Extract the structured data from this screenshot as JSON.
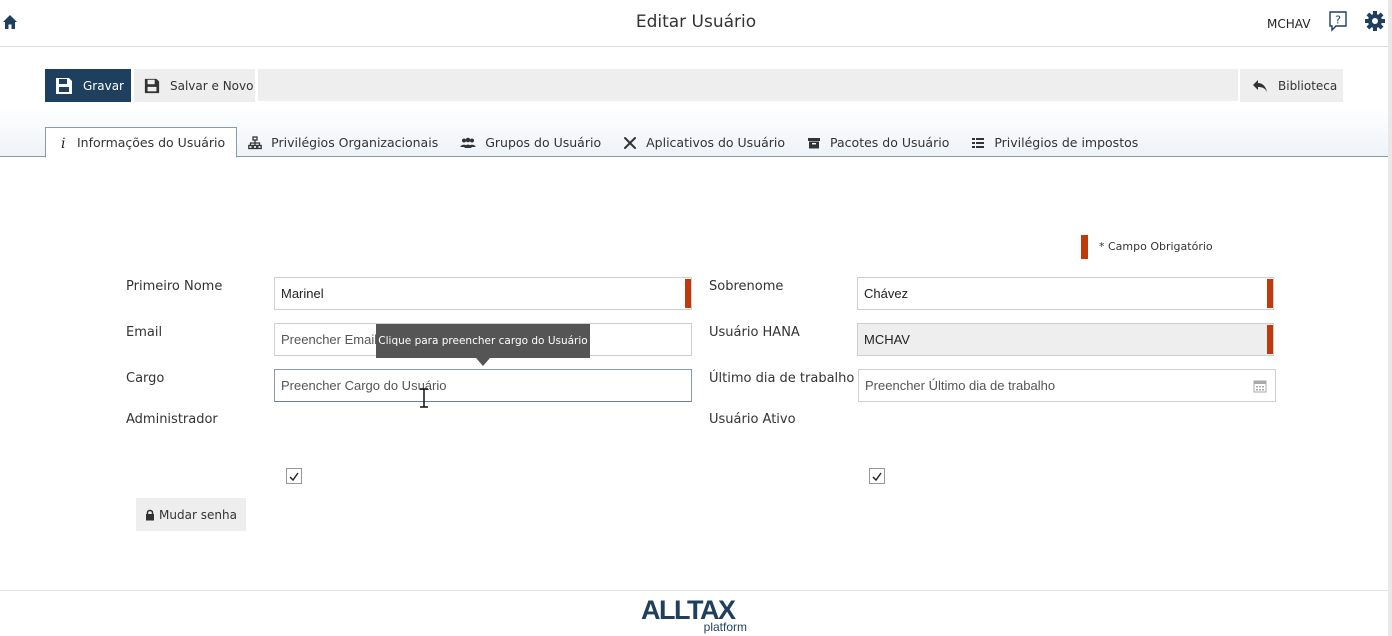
{
  "header": {
    "title": "Editar Usuário",
    "user": "MCHAV",
    "icons": [
      "home-icon",
      "help-icon",
      "gear-icon"
    ]
  },
  "toolbar": {
    "save_label": "Gravar",
    "save_new_label": "Salvar e Novo",
    "library_label": "Biblioteca"
  },
  "tabs": [
    {
      "label": "Informações do Usuário",
      "icon": "info-icon",
      "active": true
    },
    {
      "label": "Privilégios Organizacionais",
      "icon": "org-chart-icon"
    },
    {
      "label": "Grupos do Usuário",
      "icon": "users-icon"
    },
    {
      "label": "Aplicativos do Usuário",
      "icon": "tools-icon"
    },
    {
      "label": "Pacotes do Usuário",
      "icon": "archive-icon"
    },
    {
      "label": "Privilégios de impostos",
      "icon": "list-icon"
    }
  ],
  "form": {
    "required_note": "* Campo Obrigatório",
    "first_name": {
      "label": "Primeiro Nome",
      "value": "Marinel"
    },
    "last_name": {
      "label": "Sobrenome",
      "value": "Chávez"
    },
    "email": {
      "label": "Email",
      "value": "",
      "placeholder": "Preencher Email do Usuário"
    },
    "hana_user": {
      "label": "Usuário HANA",
      "value": "MCHAV"
    },
    "position": {
      "label": "Cargo",
      "value": "",
      "placeholder": "Preencher Cargo do Usuário"
    },
    "last_work_day": {
      "label": "Último dia de trabalho",
      "value": "",
      "placeholder": "Preencher Último dia de trabalho"
    },
    "admin": {
      "label": "Administrador",
      "checked": true
    },
    "active_user": {
      "label": "Usuário Ativo",
      "checked": true
    },
    "change_password_label": "Mudar senha"
  },
  "tooltip": {
    "text": "Clique para preencher cargo do Usuário"
  },
  "footer": {
    "logo_main": "ALLTAX",
    "logo_sub": "platform"
  },
  "colors": {
    "primary": "#1e3f5e",
    "required": "#c0390b",
    "button_bg": "#eeeeee"
  }
}
